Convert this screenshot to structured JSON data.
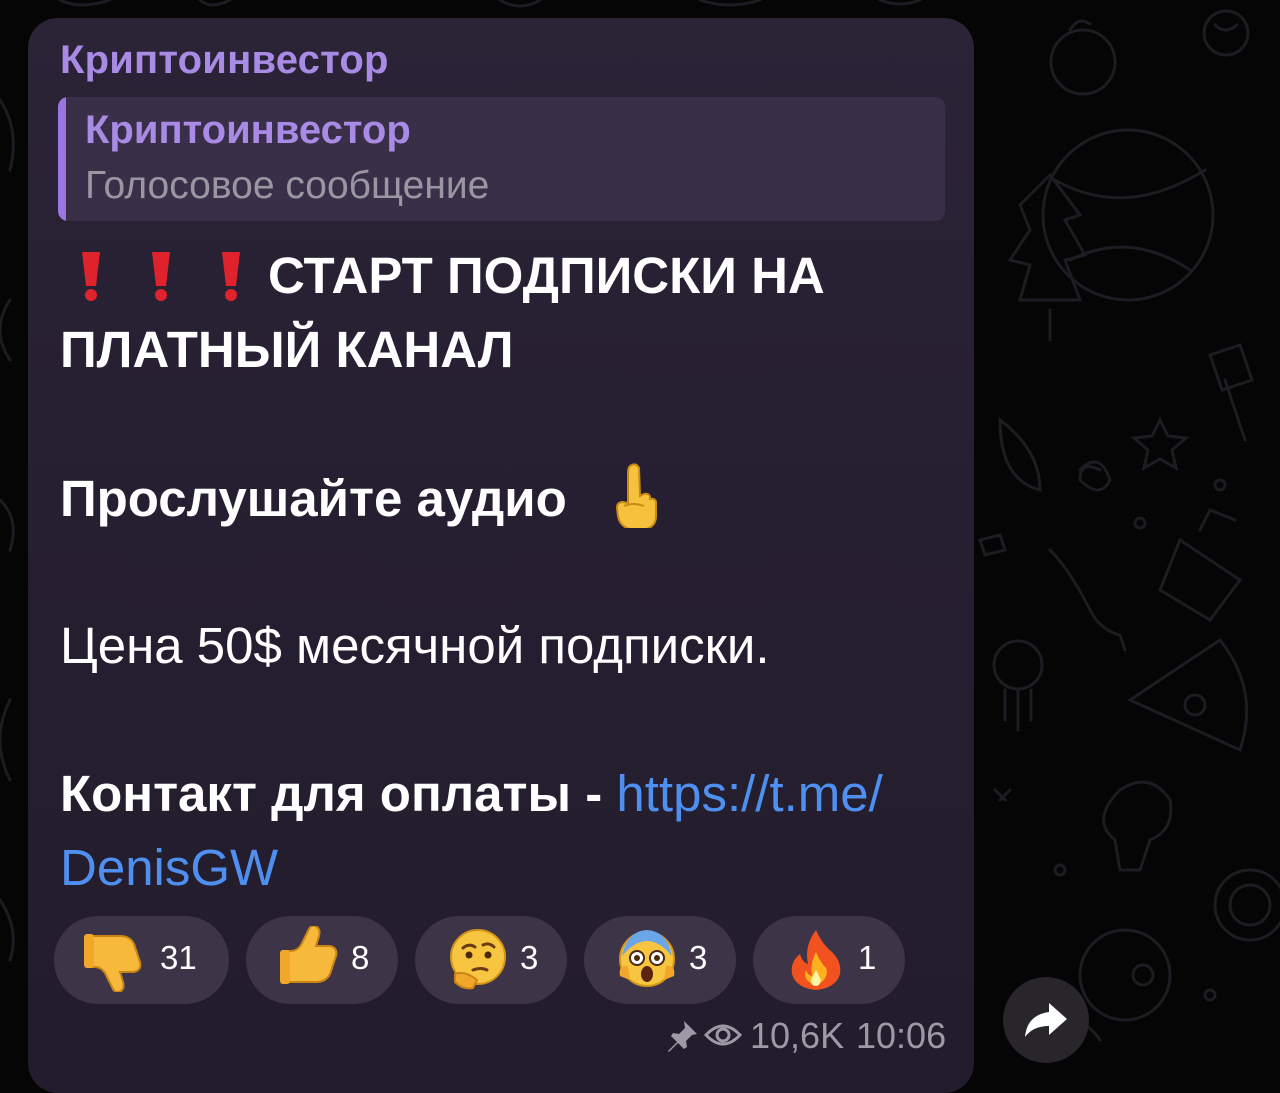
{
  "message": {
    "sender_name": "Криптоинвестор",
    "reply": {
      "author": "Криптоинвестор",
      "preview_text": "Голосовое сообщение"
    },
    "headline": {
      "line1": "СТАРТ ПОДПИСКИ НА",
      "line2": "ПЛАТНЫЙ КАНАЛ",
      "prefix_icons": [
        "exclamation-icon",
        "exclamation-icon",
        "exclamation-icon"
      ]
    },
    "listen": "Прослушайте аудио",
    "listen_icon": "pointing-up-finger-icon",
    "price": "Цена 50$ месячной подписки.",
    "contact_label": "Контакт для оплаты - ",
    "contact_link_part1": "https://t.me/",
    "contact_link_part2": "DenisGW",
    "reactions": [
      {
        "icon": "thumbs-down-icon",
        "count": "31"
      },
      {
        "icon": "thumbs-up-icon",
        "count": "8"
      },
      {
        "icon": "thinking-face-icon",
        "count": "3"
      },
      {
        "icon": "screaming-face-icon",
        "count": "3"
      },
      {
        "icon": "fire-icon",
        "count": "1"
      }
    ],
    "meta": {
      "pinned_icon": "pin-icon",
      "views_icon": "eye-icon",
      "views": "10,6K",
      "time": "10:06"
    }
  },
  "share_button": {
    "icon": "share-arrow-icon"
  },
  "colors": {
    "accent": "#a98be6",
    "link": "#4e8ff0",
    "bubble": "#261f31",
    "background": "#050505"
  }
}
